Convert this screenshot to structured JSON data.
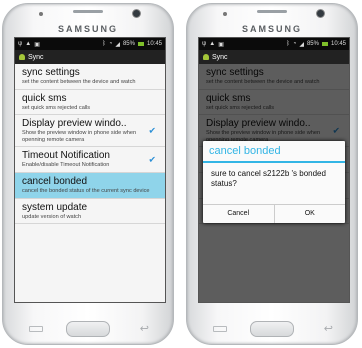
{
  "brand": "SAMSUNG",
  "status_bar": {
    "time": "10:45",
    "battery": "85%"
  },
  "action_bar": {
    "title": "Sync"
  },
  "settings": {
    "sync": {
      "title": "sync settings",
      "subtitle": "set the content between the device and watch"
    },
    "sms": {
      "title": "quick sms",
      "subtitle": "set quick sms rejected calls"
    },
    "preview": {
      "title": "Display preview windo..",
      "subtitle": "Show the preview window in phone side when openning remote camera",
      "checked": true
    },
    "timeout": {
      "title": "Timeout Notification",
      "subtitle": "Enable/disable Timeout Notification",
      "checked": true
    },
    "cancel": {
      "title": "cancel bonded",
      "subtitle": "cancel the bonded status of the current sync device"
    },
    "update": {
      "title": "system update",
      "subtitle": "update version of watch"
    }
  },
  "dialog": {
    "title": "cancel bonded",
    "message": "sure to cancel s2122b 's bonded status?",
    "cancel_label": "Cancel",
    "ok_label": "OK"
  },
  "colors": {
    "highlight": "#8fd4ea",
    "accent": "#33b5e5"
  },
  "icons": {
    "signal": "signal-icon",
    "wifi": "wifi-icon",
    "battery": "battery-icon",
    "app": "android-icon",
    "check": "checkbox-checked-icon",
    "menu": "menu-key-icon",
    "home": "home-key-icon",
    "back": "back-key-icon"
  }
}
